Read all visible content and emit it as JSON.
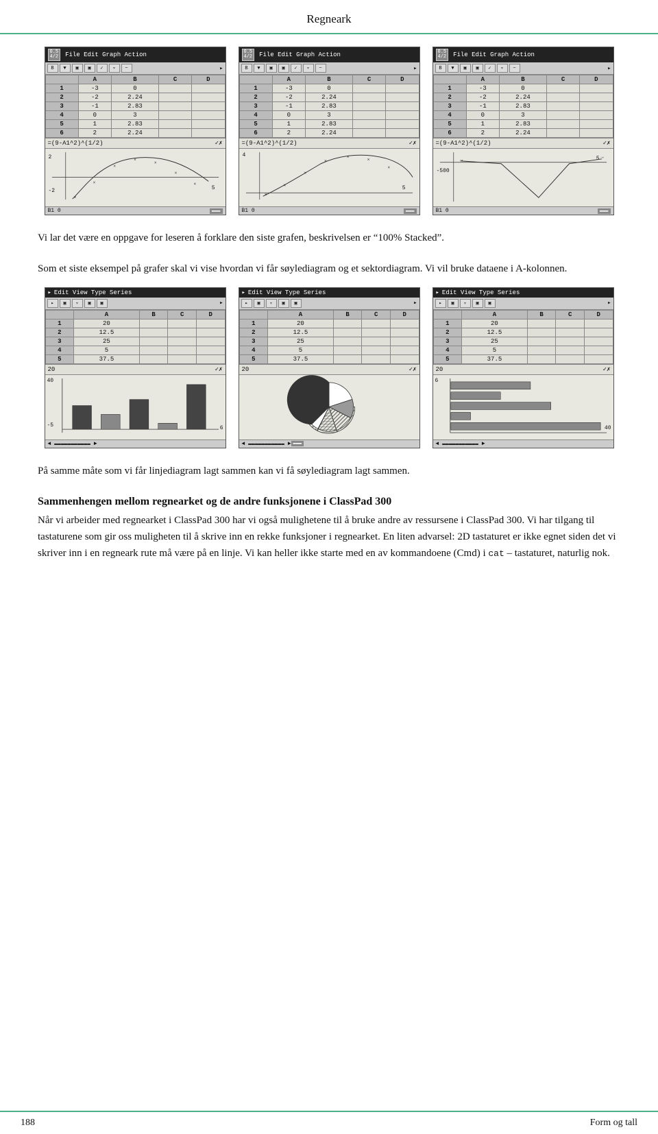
{
  "header": {
    "title": "Regneark"
  },
  "footer": {
    "page_number": "188",
    "section": "Form og tall"
  },
  "calc_screens": [
    {
      "menubar": "File  Edit  Graph  Action",
      "toolbar_btns": [
        "B",
        "▼",
        "▣",
        "▣",
        "✓▣",
        "▿▣",
        "▸"
      ],
      "table": {
        "headers": [
          "",
          "A",
          "B",
          "C",
          "D"
        ],
        "rows": [
          [
            "1",
            "-3",
            "0",
            "",
            ""
          ],
          [
            "2",
            "-2",
            "2.24",
            "",
            ""
          ],
          [
            "3",
            "-1",
            "2.83",
            "",
            ""
          ],
          [
            "4",
            "0",
            "3",
            "",
            ""
          ],
          [
            "5",
            "1",
            "2.83",
            "",
            ""
          ],
          [
            "6",
            "2",
            "2.24",
            "",
            ""
          ]
        ]
      },
      "formula": "=(9-A1^2)^(1/2)",
      "graph_type": "curve1",
      "status": "B1  0"
    },
    {
      "menubar": "File  Edit  Graph  Action",
      "toolbar_btns": [
        "B",
        "▼",
        "▣",
        "▣",
        "✓▣",
        "▿▣",
        "▸"
      ],
      "table": {
        "headers": [
          "",
          "A",
          "B",
          "C",
          "D"
        ],
        "rows": [
          [
            "1",
            "-3",
            "0",
            "",
            ""
          ],
          [
            "2",
            "-2",
            "2.24",
            "",
            ""
          ],
          [
            "3",
            "-1",
            "2.83",
            "",
            ""
          ],
          [
            "4",
            "0",
            "3",
            "",
            ""
          ],
          [
            "5",
            "1",
            "2.83",
            "",
            ""
          ],
          [
            "6",
            "2",
            "2.24",
            "",
            ""
          ]
        ]
      },
      "formula": "=(9-A1^2)^(1/2)",
      "graph_type": "curve2",
      "status": "B1  0"
    },
    {
      "menubar": "File  Edit  Graph  Action",
      "toolbar_btns": [
        "B",
        "▼",
        "▣",
        "▣",
        "✓▣",
        "▿▣",
        "▸"
      ],
      "table": {
        "headers": [
          "",
          "A",
          "B",
          "C",
          "D"
        ],
        "rows": [
          [
            "1",
            "-3",
            "0",
            "",
            ""
          ],
          [
            "2",
            "-2",
            "2.24",
            "",
            ""
          ],
          [
            "3",
            "-1",
            "2.83",
            "",
            ""
          ],
          [
            "4",
            "0",
            "3",
            "",
            ""
          ],
          [
            "5",
            "1",
            "2.83",
            "",
            ""
          ],
          [
            "6",
            "2",
            "2.24",
            "",
            ""
          ]
        ]
      },
      "formula": "=(9-A1^2)^(1/2)",
      "graph_type": "curve3",
      "status": "B1  0"
    }
  ],
  "text1": "Vi lar det være en oppgave for leseren å forklare den siste grafen, beskrivelsen er “100% Stacked”.",
  "text2": "Som et siste eksempel på grafer skal vi vise hvordan vi får søylediagram og et sektordiagram. Vi vil bruke dataene i A-kolonnen.",
  "spread_screens": [
    {
      "menubar": "Edit  View  Type  Series",
      "toolbar_btns": [
        "▸",
        "▣",
        "▣",
        "▿▣",
        "▸"
      ],
      "table": {
        "headers": [
          "",
          "A",
          "B",
          "C",
          "D"
        ],
        "rows": [
          [
            "1",
            "20",
            "",
            "",
            ""
          ],
          [
            "2",
            "12.5",
            "",
            "",
            ""
          ],
          [
            "3",
            "25",
            "",
            "",
            ""
          ],
          [
            "4",
            "5",
            "",
            "",
            ""
          ],
          [
            "5",
            "37.5",
            "",
            "",
            ""
          ]
        ]
      },
      "input_val": "20",
      "chart_type": "bar",
      "chart_label_top": "40",
      "chart_label_bottom": "-5",
      "chart_label_right": "6"
    },
    {
      "menubar": "Edit  View  Type  Series",
      "toolbar_btns": [
        "▸",
        "▣",
        "▣",
        "▿▣",
        "▸"
      ],
      "table": {
        "headers": [
          "",
          "A",
          "B",
          "C",
          "D"
        ],
        "rows": [
          [
            "1",
            "20",
            "",
            "",
            ""
          ],
          [
            "2",
            "12.5",
            "",
            "",
            ""
          ],
          [
            "3",
            "25",
            "",
            "",
            ""
          ],
          [
            "4",
            "5",
            "",
            "",
            ""
          ],
          [
            "5",
            "37.5",
            "",
            "",
            ""
          ]
        ]
      },
      "input_val": "20",
      "chart_type": "pie"
    },
    {
      "menubar": "Edit  View  Type  Series",
      "toolbar_btns": [
        "▸",
        "▣",
        "▣",
        "▿▣",
        "▸"
      ],
      "table": {
        "headers": [
          "",
          "A",
          "B",
          "C",
          "D"
        ],
        "rows": [
          [
            "1",
            "20",
            "",
            "",
            ""
          ],
          [
            "2",
            "12.5",
            "",
            "",
            ""
          ],
          [
            "3",
            "25",
            "",
            "",
            ""
          ],
          [
            "4",
            "5",
            "",
            "",
            ""
          ],
          [
            "5",
            "37.5",
            "",
            "",
            ""
          ]
        ]
      },
      "input_val": "20",
      "chart_type": "hbar",
      "chart_label_top": "6",
      "chart_label_bottom": "40"
    }
  ],
  "text3": "På samme måte som vi får linjediagram lagt sammen kan vi få søylediagram lagt sammen.",
  "section_heading": "Sammenhengen mellom regnearket og de andre funksjonene i ClassPad 300",
  "section_body": [
    "Når vi arbeider med regnearket i ClassPad 300 har vi også mulighetene til å bruke andre av ressursene i ClassPad 300. Vi har tilgang til tastaturene som gir oss muligheten til å skrive inn en rekke funksjoner i regnearket. En liten advarsel: 2D tastaturet er ikke egnet siden det vi skriver inn i en regneark rute må være på en linje. Vi kan heller ikke starte med en av kommandoene (Cmd) i",
    "cat",
    " – tastaturet, naturlig nok."
  ]
}
